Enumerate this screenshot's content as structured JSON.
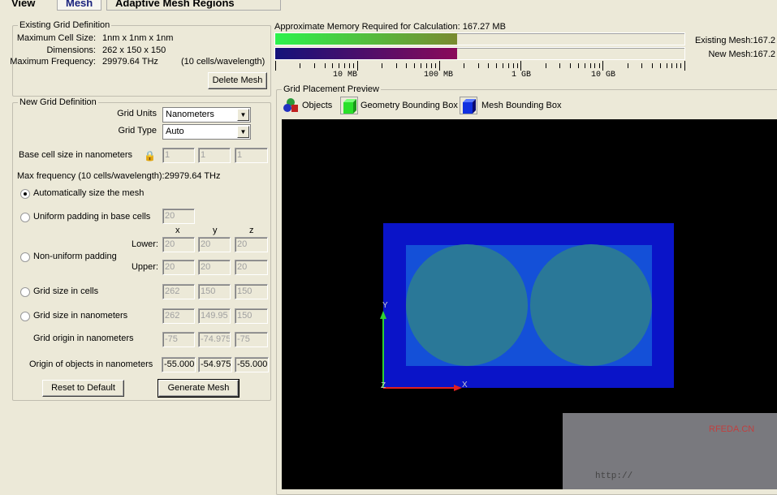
{
  "tabs": [
    {
      "label": "View"
    },
    {
      "label": "Mesh"
    },
    {
      "label": "Adaptive Mesh Regions"
    }
  ],
  "existing": {
    "title": "Existing Grid Definition",
    "max_cell_label": "Maximum Cell Size:",
    "max_cell_value": "1nm x 1nm x 1nm",
    "dimensions_label": "Dimensions:",
    "dimensions_value": "262 x 150 x 150",
    "max_freq_label": "Maximum Frequency:",
    "max_freq_value": "29979.64 THz",
    "cells_note": "(10 cells/wavelength)",
    "delete_button": "Delete Mesh"
  },
  "new_grid": {
    "title": "New Grid Definition",
    "grid_units_label": "Grid Units",
    "grid_units_value": "Nanometers",
    "grid_type_label": "Grid Type",
    "grid_type_value": "Auto",
    "base_cell_label": "Base cell size in nanometers",
    "base_cell": [
      "1",
      "1",
      "1"
    ],
    "max_freq_text": "Max frequency (10 cells/wavelength):29979.64 THz",
    "auto_label": "Automatically size the mesh",
    "uniform_label": "Uniform padding in base cells",
    "uniform_value": "20",
    "axis_x": "x",
    "axis_y": "y",
    "axis_z": "z",
    "nonuniform_label": "Non-uniform padding",
    "lower_label": "Lower:",
    "lower": [
      "20",
      "20",
      "20"
    ],
    "upper_label": "Upper:",
    "upper": [
      "20",
      "20",
      "20"
    ],
    "cells_label": "Grid size in cells",
    "cells": [
      "262",
      "150",
      "150"
    ],
    "nm_label": "Grid size in nanometers",
    "nm": [
      "262",
      "149.95",
      "150"
    ],
    "origin_label": "Grid origin in nanometers",
    "origin": [
      "-75",
      "-74.975",
      "-75"
    ],
    "obj_origin_label": "Origin of objects in nanometers",
    "obj_origin": [
      "-55.000",
      "-54.975",
      "-55.000"
    ],
    "reset_button": "Reset to Default",
    "generate_button": "Generate Mesh"
  },
  "memory": {
    "title": "Approximate Memory Required for Calculation: 167.27 MB",
    "existing_label": "Existing Mesh:167.2",
    "new_label": "New Mesh:167.2",
    "fill_fraction": 0.444,
    "scale_labels": [
      "10 MB",
      "100 MB",
      "1 GB",
      "10 GB"
    ]
  },
  "preview": {
    "title": "Grid Placement Preview",
    "objects": "Objects",
    "geometry": "Geometry Bounding Box",
    "mesh": "Mesh Bounding Box",
    "axis_x": "X",
    "axis_y": "Y",
    "axis_z": "Z"
  },
  "watermark": {
    "text": "RFEDA.CN",
    "url": "http://"
  }
}
